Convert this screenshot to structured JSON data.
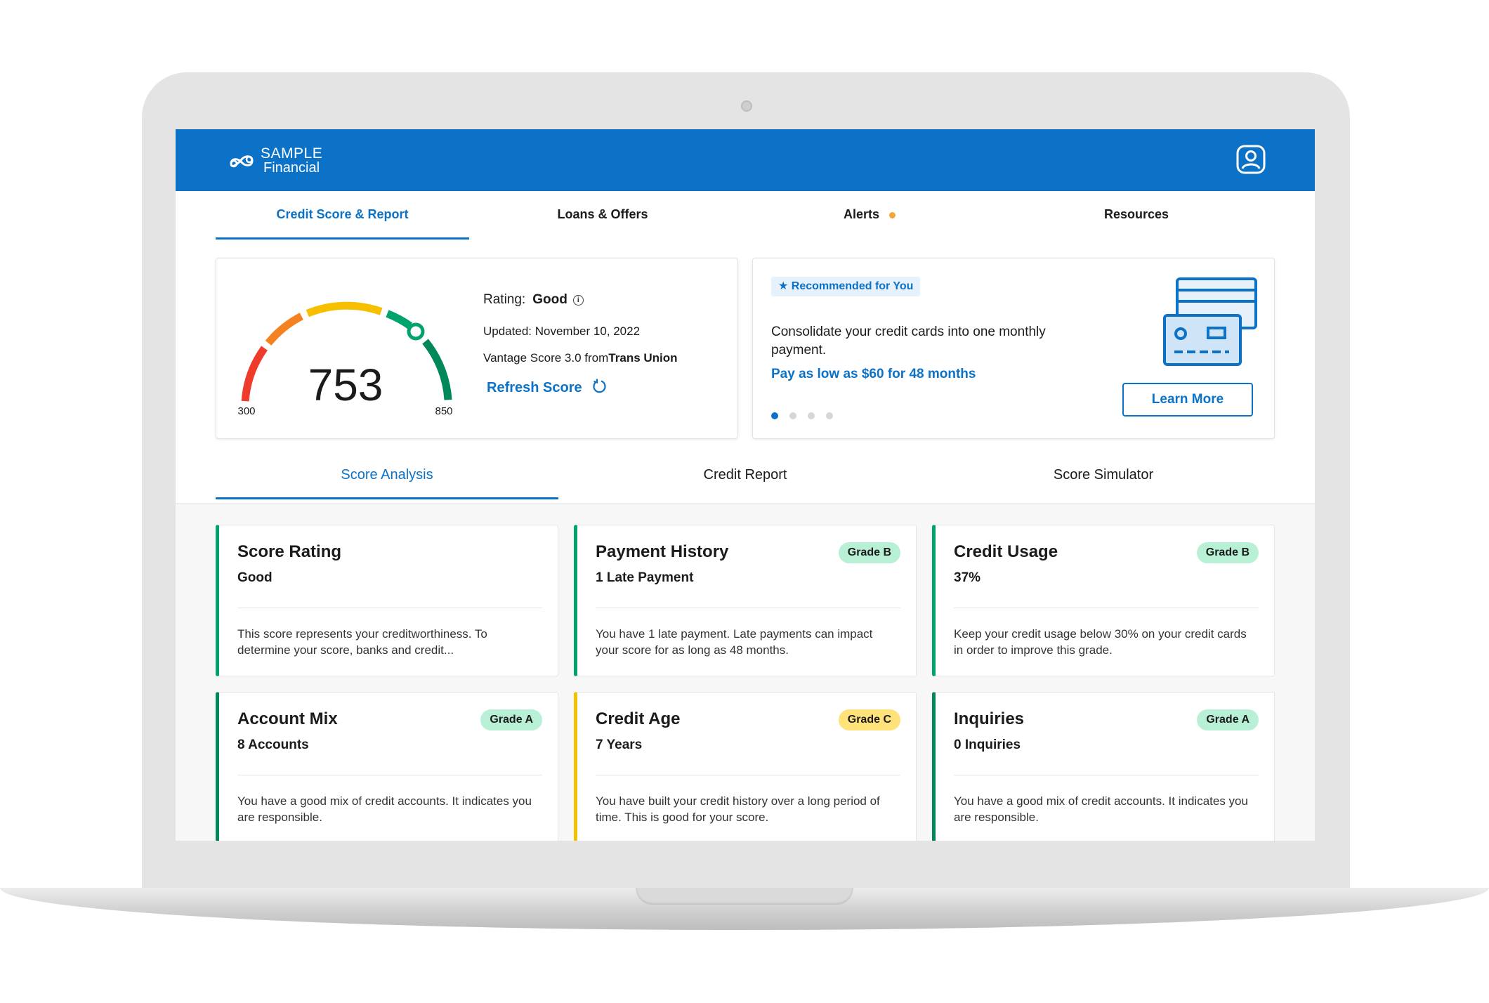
{
  "brand": {
    "line1": "SAMPLE",
    "line2": "Financial"
  },
  "nav": {
    "items": [
      {
        "label": "Credit Score & Report"
      },
      {
        "label": "Loans & Offers"
      },
      {
        "label": "Alerts"
      },
      {
        "label": "Resources"
      }
    ],
    "active_index": 0
  },
  "score": {
    "value": "753",
    "min_label": "300",
    "max_label": "850",
    "rating_label": "Rating:",
    "rating_value": "Good",
    "updated": "Updated: November 10, 2022",
    "source_prefix": "Vantage Score 3.0 from",
    "source_bureau": "Trans Union",
    "refresh_label": "Refresh Score"
  },
  "promo": {
    "badge": "Recommended for You",
    "text": "Consolidate your credit cards into one monthly payment.",
    "offer": "Pay as low as $60 for 48 months",
    "button": "Learn More",
    "slides_total": 4,
    "active_slide": 1
  },
  "subtabs": {
    "items": [
      {
        "label": "Score Analysis"
      },
      {
        "label": "Credit Report"
      },
      {
        "label": "Score Simulator"
      }
    ],
    "active_index": 0
  },
  "metrics": [
    {
      "title": "Score Rating",
      "value": "Good",
      "grade": "",
      "description": "This score represents your creditworthiness. To determine your score, banks and credit...",
      "accent": "#00a36c"
    },
    {
      "title": "Payment History",
      "value": "1 Late Payment",
      "grade": "Grade B",
      "description": "You have 1 late payment. Late payments can impact your score for as long as 48 months.",
      "accent": "#00a36c"
    },
    {
      "title": "Credit Usage",
      "value": "37%",
      "grade": "Grade B",
      "description": "Keep your credit usage below 30% on your credit cards in order to improve this grade.",
      "accent": "#00a36c"
    },
    {
      "title": "Account Mix",
      "value": "8 Accounts",
      "grade": "Grade A",
      "description": "You have a good mix of credit accounts. It indicates you are responsible.",
      "accent": "#00875a"
    },
    {
      "title": "Credit Age",
      "value": "7 Years",
      "grade": "Grade C",
      "description": "You have built your credit history over a long period of time. This is good for your score.",
      "accent": "#f2c200"
    },
    {
      "title": "Inquiries",
      "value": "0 Inquiries",
      "grade": "Grade A",
      "description": "You have a good mix of credit accounts. It indicates you are responsible.",
      "accent": "#00875a"
    }
  ],
  "colors": {
    "brand_blue": "#0b72c7",
    "grade_green_bg": "#b8f0d6",
    "grade_yellow_bg": "#ffe27a",
    "alert_dot": "#f2a633"
  },
  "icons": {
    "logo": "infinity-logo-icon",
    "profile": "user-profile-icon",
    "info": "info-icon",
    "refresh": "refresh-icon",
    "star": "star-icon",
    "credit_card": "credit-card-illustration"
  }
}
